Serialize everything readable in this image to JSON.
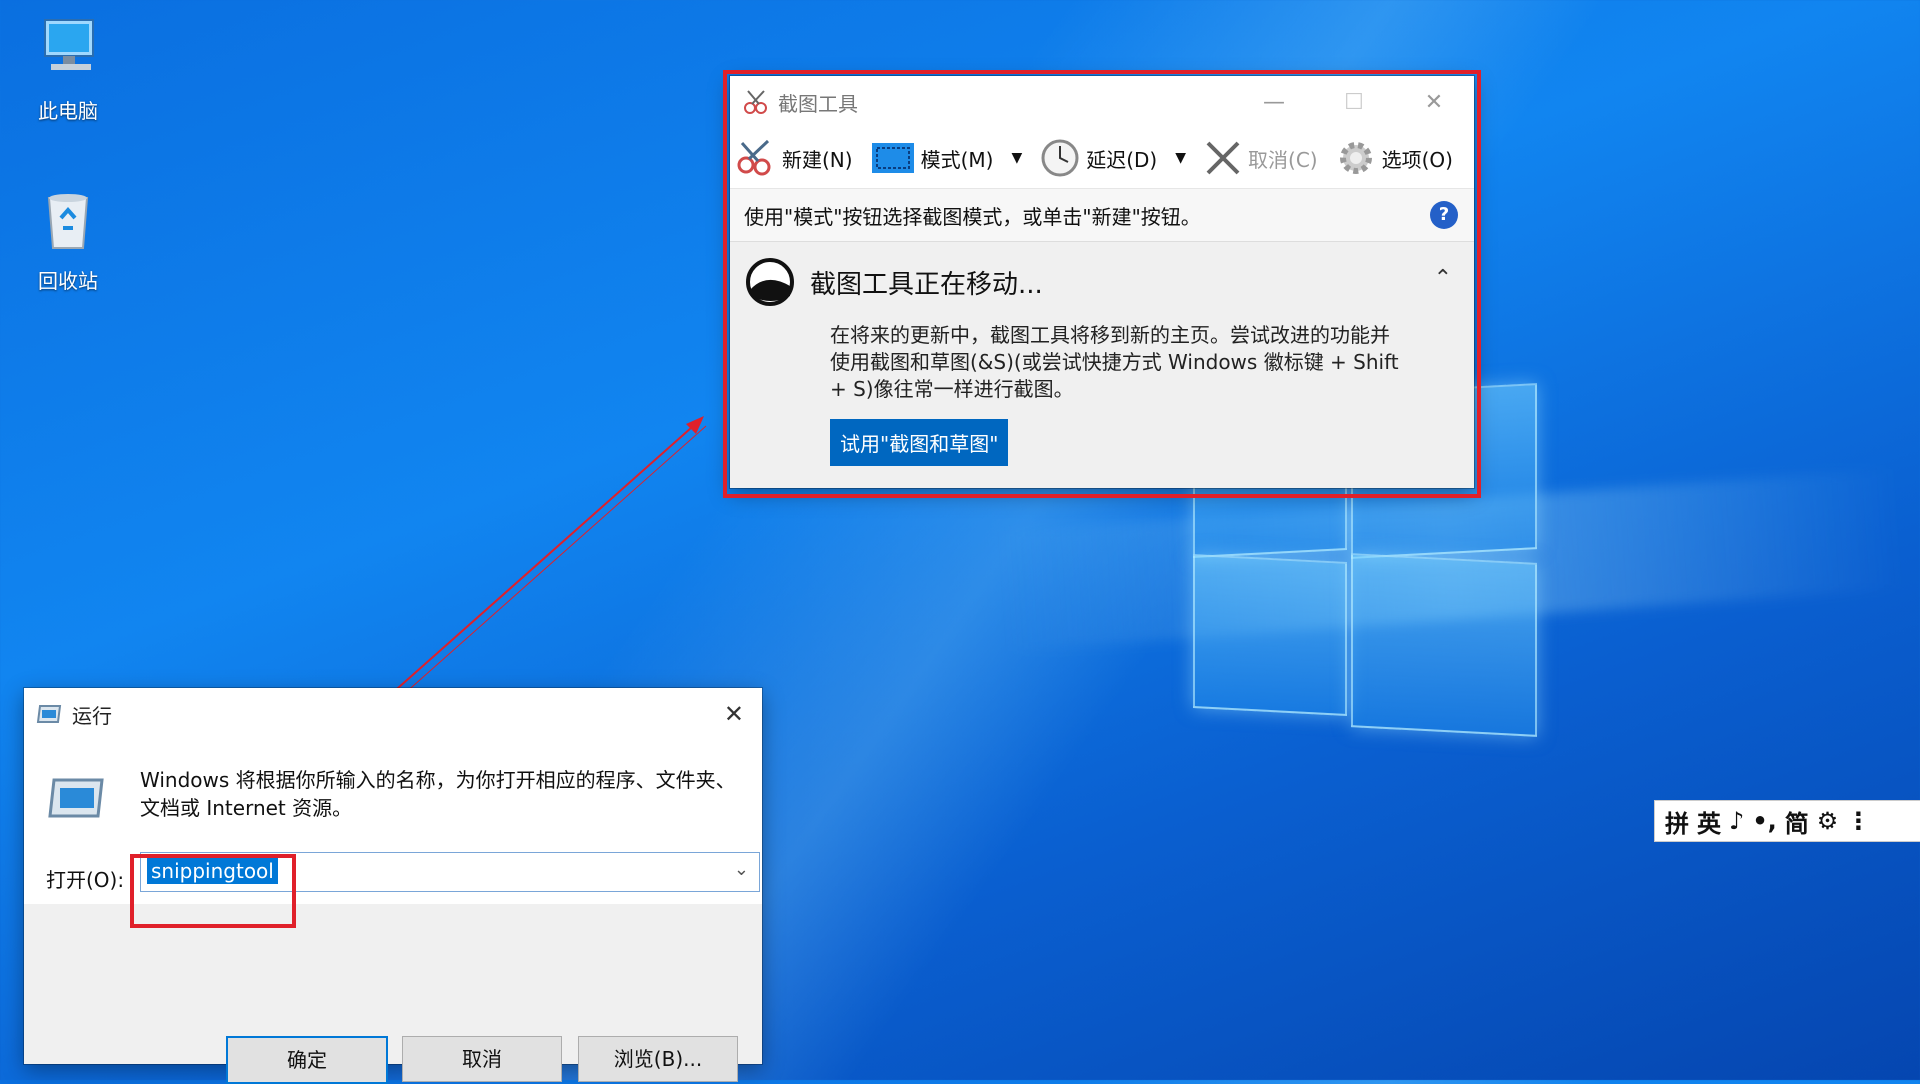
{
  "desktop": {
    "icons": [
      {
        "label": "此电脑"
      },
      {
        "label": "回收站"
      }
    ]
  },
  "snipping_tool": {
    "title": "截图工具",
    "toolbar": {
      "new": "新建(N)",
      "mode": "模式(M)",
      "delay": "延迟(D)",
      "cancel": "取消(C)",
      "options": "选项(O)"
    },
    "hint": "使用\"模式\"按钮选择截图模式，或单击\"新建\"按钮。",
    "help": "?",
    "notice": {
      "heading": "截图工具正在移动...",
      "body": "在将来的更新中，截图工具将移到新的主页。尝试改进的功能并使用截图和草图(&S)(或尝试快捷方式 Windows 徽标键 + Shift + S)像往常一样进行截图。",
      "button": "试用\"截图和草图\""
    }
  },
  "run_dialog": {
    "title": "运行",
    "description": "Windows 将根据你所输入的名称，为你打开相应的程序、文件夹、文档或 Internet 资源。",
    "open_label": "打开(O):",
    "input_value": "snippingtool",
    "buttons": {
      "ok": "确定",
      "cancel": "取消",
      "browse": "浏览(B)..."
    }
  },
  "ime": {
    "items": [
      "拼",
      "英",
      "♪",
      "•,",
      "简",
      "⚙",
      "⋮"
    ]
  },
  "colors": {
    "highlight_red": "#e0202a",
    "accent_blue": "#0078d7"
  }
}
